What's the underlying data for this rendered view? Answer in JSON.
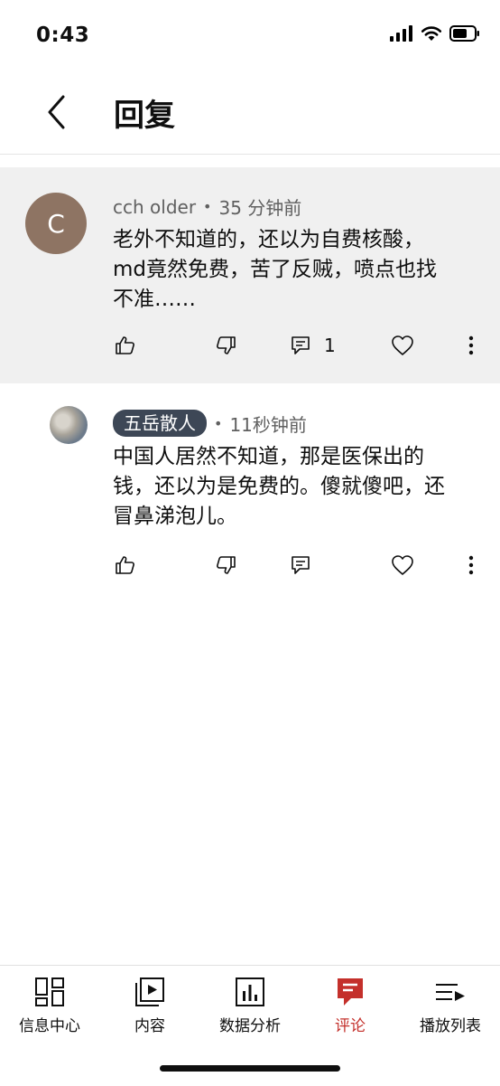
{
  "status_bar": {
    "time": "0:43"
  },
  "header": {
    "title": "回复"
  },
  "comment": {
    "author": "cch older",
    "avatar_letter": "C",
    "separator": "•",
    "time": "35 分钟前",
    "text_lines": [
      "老外不知道的，还以为自费核酸，",
      "md竟然免费，苦了反贼，喷点也找",
      "不准……"
    ],
    "reply_count": "1"
  },
  "reply": {
    "author": "五岳散人",
    "separator": "•",
    "time": "11秒钟前",
    "text_lines": [
      "中国人居然不知道，那是医保出的",
      "钱，还以为是免费的。傻就傻吧，还",
      "冒鼻涕泡儿。"
    ]
  },
  "bottom_nav": [
    {
      "label": "信息中心",
      "icon": "dashboard-icon"
    },
    {
      "label": "内容",
      "icon": "content-icon"
    },
    {
      "label": "数据分析",
      "icon": "analytics-icon"
    },
    {
      "label": "评论",
      "icon": "comments-icon",
      "active": true
    },
    {
      "label": "播放列表",
      "icon": "playlist-icon"
    }
  ],
  "colors": {
    "accent": "#c4302b",
    "comment_bg": "#f0f0f0",
    "avatar_bg": "#8e7463",
    "chip_bg": "#3d4756"
  }
}
